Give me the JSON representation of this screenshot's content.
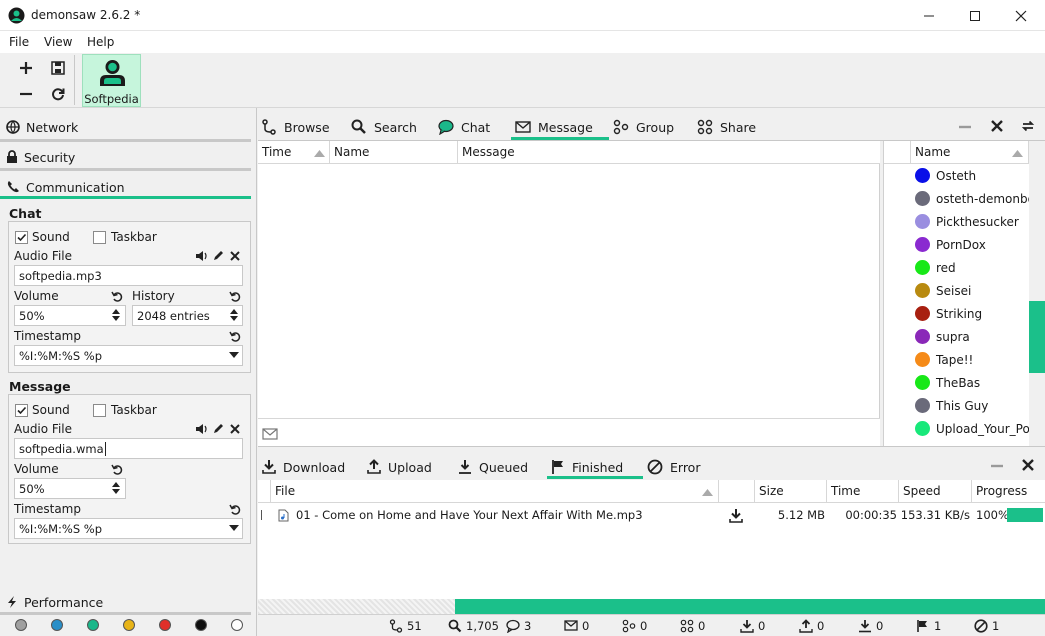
{
  "app": {
    "title": "demonsaw 2.6.2 *"
  },
  "menu": [
    "File",
    "View",
    "Help"
  ],
  "toolbar": {
    "profile_label": "Softpedia"
  },
  "left_panel": {
    "sections": {
      "network": "Network",
      "security": "Security",
      "communication": "Communication",
      "performance": "Performance"
    },
    "chat": {
      "title": "Chat",
      "sound_label": "Sound",
      "sound_checked": true,
      "taskbar_label": "Taskbar",
      "taskbar_checked": false,
      "audio_label": "Audio File",
      "audio_value": "softpedia.mp3",
      "volume_label": "Volume",
      "volume_value": "50%",
      "history_label": "History",
      "history_value": "2048 entries",
      "timestamp_label": "Timestamp",
      "timestamp_value": "%I:%M:%S %p"
    },
    "message": {
      "title": "Message",
      "sound_label": "Sound",
      "sound_checked": true,
      "taskbar_label": "Taskbar",
      "taskbar_checked": false,
      "audio_label": "Audio File",
      "audio_value": "softpedia.wma",
      "volume_label": "Volume",
      "volume_value": "50%",
      "timestamp_label": "Timestamp",
      "timestamp_value": "%I:%M:%S %p"
    },
    "color_dots": [
      "#a0a0a0",
      "#2a8fc8",
      "#1bb78a",
      "#e8b418",
      "#e0302a",
      "#101010",
      "#ffffff"
    ]
  },
  "top_tabs": [
    {
      "label": "Browse",
      "icon": "route-icon"
    },
    {
      "label": "Search",
      "icon": "search-icon"
    },
    {
      "label": "Chat",
      "icon": "chat-icon"
    },
    {
      "label": "Message",
      "icon": "envelope-icon",
      "active": true
    },
    {
      "label": "Group",
      "icon": "group-icon"
    },
    {
      "label": "Share",
      "icon": "share-icon"
    }
  ],
  "message_table": {
    "columns": [
      "Time",
      "Name",
      "Message"
    ]
  },
  "users": {
    "column": "Name",
    "items": [
      {
        "name": "Osteth",
        "color": "#0a10e8"
      },
      {
        "name": "osteth-demonbox",
        "color": "#6a6a7a"
      },
      {
        "name": "Pickthesucker",
        "color": "#9a8ee0"
      },
      {
        "name": "PornDox",
        "color": "#8a2ad0"
      },
      {
        "name": "red",
        "color": "#18e818"
      },
      {
        "name": "Seisei",
        "color": "#b88a10"
      },
      {
        "name": "Striking",
        "color": "#a82010"
      },
      {
        "name": "supra",
        "color": "#8a28b8"
      },
      {
        "name": "Tape!!",
        "color": "#f58a18"
      },
      {
        "name": "TheBas",
        "color": "#18e818"
      },
      {
        "name": "This Guy",
        "color": "#6a6a7a"
      },
      {
        "name": "Upload_Your_Porn",
        "color": "#18e87a"
      }
    ]
  },
  "transfer_tabs": [
    {
      "label": "Download",
      "icon": "download-icon"
    },
    {
      "label": "Upload",
      "icon": "upload-icon"
    },
    {
      "label": "Queued",
      "icon": "queued-icon"
    },
    {
      "label": "Finished",
      "icon": "flag-icon",
      "active": true
    },
    {
      "label": "Error",
      "icon": "error-icon"
    }
  ],
  "transfer_table": {
    "columns": [
      "File",
      "Size",
      "Time",
      "Speed",
      "Progress"
    ],
    "rows": [
      {
        "file": "01 - Come on Home and Have Your Next Affair With Me.mp3",
        "size": "5.12 MB",
        "time": "00:00:35",
        "speed": "153.31 KB/s",
        "progress": "100%",
        "progress_value": 1.0
      }
    ]
  },
  "status_bar": [
    "51",
    "1,705",
    "3",
    "0",
    "0",
    "0",
    "0",
    "0",
    "0",
    "1",
    "1"
  ]
}
